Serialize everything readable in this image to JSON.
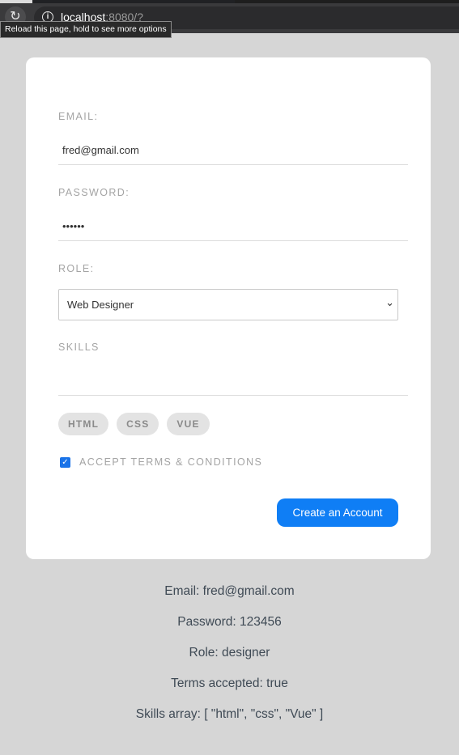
{
  "browser": {
    "url_host": "localhost",
    "url_rest": ":8080/?",
    "reload_tooltip": "Reload this page, hold to see more options"
  },
  "form": {
    "email": {
      "label": "EMAIL:",
      "value": "fred@gmail.com"
    },
    "password": {
      "label": "PASSWORD:",
      "value": "123456",
      "masked": "••••••"
    },
    "role": {
      "label": "ROLE:",
      "selected": "Web Designer"
    },
    "skills": {
      "label": "SKILLS",
      "input_value": "",
      "chips": [
        "HTML",
        "CSS",
        "VUE"
      ]
    },
    "terms": {
      "label": "ACCEPT TERMS & CONDITIONS",
      "checked": true
    },
    "submit_label": "Create an Account"
  },
  "output": {
    "email_line": "Email: fred@gmail.com",
    "password_line": "Password: 123456",
    "role_line": "Role: designer",
    "terms_line": "Terms accepted: true",
    "skills_line": "Skills array: [ \"html\", \"css\", \"Vue\" ]"
  },
  "colors": {
    "page_background": "#d6d6d6",
    "card_background": "#ffffff",
    "accent": "#0f7ef5",
    "label": "#a4a4a4",
    "output_text": "#3f4a55"
  }
}
